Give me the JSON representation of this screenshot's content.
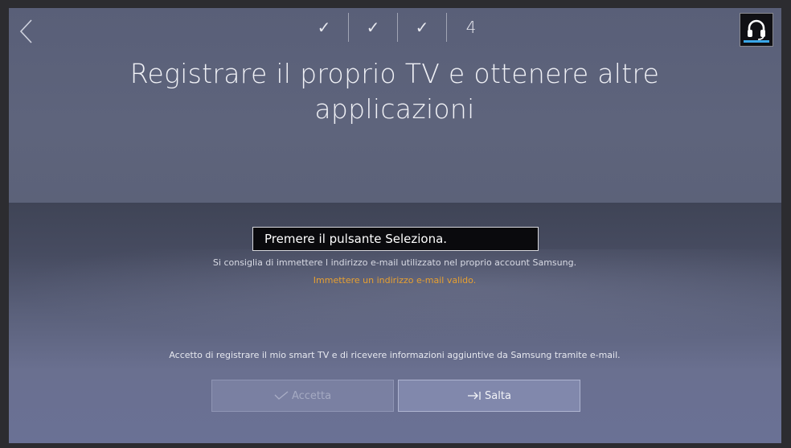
{
  "header": {
    "back_icon": "chevron-left-icon",
    "steps": [
      {
        "label": "✓",
        "icon": "check-icon",
        "state": "done"
      },
      {
        "label": "✓",
        "icon": "check-icon",
        "state": "done"
      },
      {
        "label": "✓",
        "icon": "check-icon",
        "state": "done"
      },
      {
        "label": "4",
        "state": "current"
      }
    ],
    "help_icon": "headset-icon"
  },
  "title_line1": "Registrare il proprio TV e ottenere altre",
  "title_line2": "applicazioni",
  "email_input": {
    "value": "Premere il pulsante Seleziona."
  },
  "hint": "Si consiglia di immettere l indirizzo e-mail utilizzato nel proprio account Samsung.",
  "error": "Immettere un indirizzo e-mail valido.",
  "consent": "Accetto di registrare il mio smart TV e di ricevere informazioni aggiuntive da Samsung tramite e-mail.",
  "buttons": {
    "accept_label": "Accetta",
    "accept_icon": "check-icon",
    "skip_label": "Salta",
    "skip_icon": "skip-arrow-icon"
  },
  "colors": {
    "error": "#e8a030",
    "help_bar": "#3aa7e8"
  }
}
